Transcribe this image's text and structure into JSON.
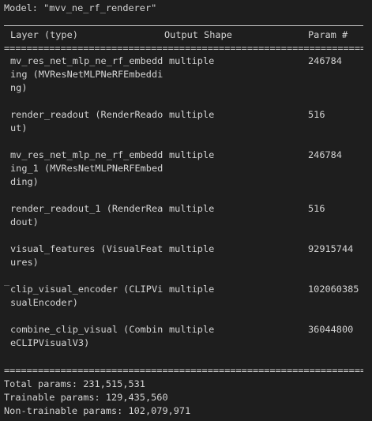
{
  "summary": {
    "model_line": "Model: \"mvv_ne_rf_renderer\"",
    "headers": {
      "layer": "Layer (type)",
      "shape": "Output Shape",
      "param": "Param #"
    },
    "rows": [
      {
        "layer_lines": [
          "mv_res_net_mlp_ne_rf_embedd",
          "ing (MVResNetMLPNeRFEmbeddi",
          "ng)"
        ],
        "shape": "multiple",
        "param": "246784"
      },
      {
        "layer_lines": [
          "render_readout (RenderReado",
          "ut)"
        ],
        "shape": "multiple",
        "param": "516"
      },
      {
        "layer_lines": [
          "mv_res_net_mlp_ne_rf_embedd",
          "ing_1 (MVResNetMLPNeRFEmbed",
          "ding)"
        ],
        "shape": "multiple",
        "param": "246784"
      },
      {
        "layer_lines": [
          "render_readout_1 (RenderRea",
          "dout)"
        ],
        "shape": "multiple",
        "param": "516"
      },
      {
        "layer_lines": [
          "visual_features (VisualFeat",
          "ures)"
        ],
        "shape": "multiple",
        "param": "92915744"
      },
      {
        "layer_lines": [
          "clip_visual_encoder (CLIPVi",
          "sualEncoder)"
        ],
        "shape": "multiple",
        "param": "102060385",
        "marker": "_"
      },
      {
        "layer_lines": [
          "combine_clip_visual (Combin",
          "eCLIPVisualV3)"
        ],
        "shape": "multiple",
        "param": "36044800"
      }
    ],
    "totals": {
      "total": "Total params: 231,515,531",
      "trainable": "Trainable params: 129,435,560",
      "non_trainable": "Non-trainable params: 102,079,971"
    },
    "rule_char": "="
  }
}
